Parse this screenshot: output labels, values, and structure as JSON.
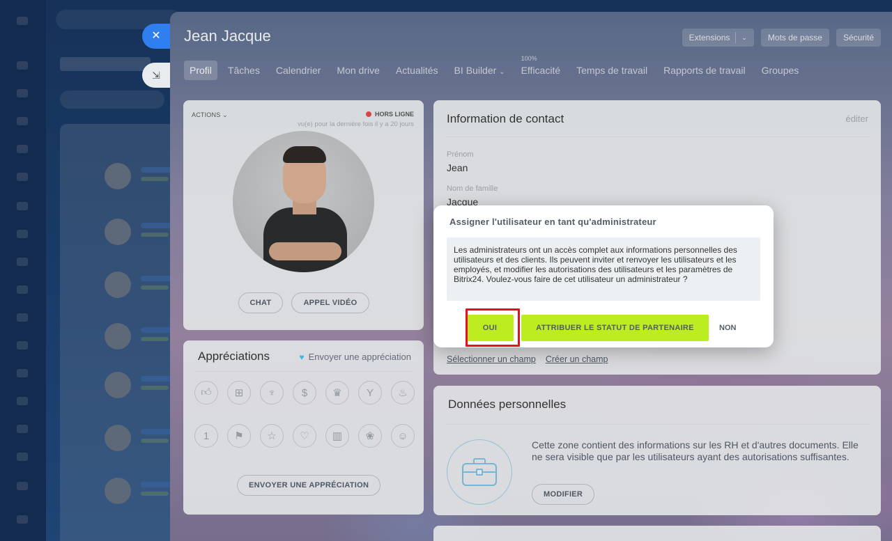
{
  "profile_name": "Jean Jacque",
  "header_buttons": {
    "extensions": "Extensions",
    "passwords": "Mots de passe",
    "security": "Sécurité"
  },
  "tabs": [
    {
      "label": "Profil",
      "active": true
    },
    {
      "label": "Tâches"
    },
    {
      "label": "Calendrier"
    },
    {
      "label": "Mon drive"
    },
    {
      "label": "Actualités"
    },
    {
      "label": "BI Builder",
      "has_dropdown": true
    },
    {
      "label": "Efficacité",
      "sup": "100%"
    },
    {
      "label": "Temps de travail"
    },
    {
      "label": "Rapports de travail"
    },
    {
      "label": "Groupes"
    }
  ],
  "profile_card": {
    "actions": "ACTIONS",
    "status": "HORS LIGNE",
    "last_seen": "vu(e) pour la dernière fois il y a 20 jours",
    "chat": "CHAT",
    "video": "APPEL VIDÉO"
  },
  "appreciations": {
    "title": "Appréciations",
    "send_link": "Envoyer une appréciation",
    "button": "ENVOYER UNE APPRÉCIATION",
    "badges_row1": [
      "thumb-up-icon",
      "gift-icon",
      "trophy-icon",
      "money-bag-icon",
      "crown-icon",
      "cocktail-icon",
      "cake-icon"
    ],
    "badges_row2": [
      "number-one-icon",
      "flag-icon",
      "star-icon",
      "heart-icon",
      "beer-icon",
      "flower-icon",
      "smile-icon"
    ]
  },
  "contact": {
    "title": "Information de contact",
    "edit": "éditer",
    "first_name_label": "Prénom",
    "first_name": "Jean",
    "last_name_label": "Nom de famille",
    "last_name": "Jacque",
    "select_field": "Sélectionner un champ",
    "create_field": "Créer un champ"
  },
  "personal": {
    "title": "Données personnelles",
    "text": "Cette zone contient des informations sur les RH et d'autres documents. Elle ne sera visible que par les utilisateurs ayant des autorisations suffisantes.",
    "button": "MODIFIER"
  },
  "modal": {
    "title": "Assigner l'utilisateur en tant qu'administrateur",
    "body": "Les administrateurs ont un accès complet aux informations personnelles des utilisateurs et des clients. Ils peuvent inviter et renvoyer les utilisateurs et les employés, et modifier les autorisations des utilisateurs et les paramètres de Bitrix24. Voulez-vous faire de cet utilisateur un administrateur ?",
    "yes": "OUI",
    "partner": "ATTRIBUER LE STATUT DE PARTENAIRE",
    "no": "NON"
  },
  "colors": {
    "accent_green": "#bbed21",
    "highlight_red": "#e5101c",
    "close_blue": "#2f7ff0",
    "offline_dot": "#ea4a45"
  }
}
